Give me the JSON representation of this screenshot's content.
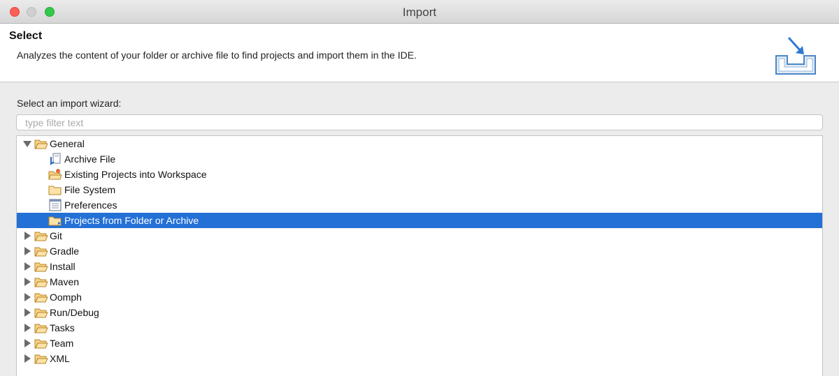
{
  "window": {
    "title": "Import"
  },
  "banner": {
    "title": "Select",
    "description": "Analyzes the content of your folder or archive file to find projects and import them in the IDE.",
    "icon": "import-wizard-icon"
  },
  "wizard": {
    "label": "Select an import wizard:",
    "filter_placeholder": "type filter text",
    "filter_value": ""
  },
  "tree": {
    "general": {
      "label": "General",
      "expanded": true,
      "children": [
        {
          "label": "Archive File",
          "icon": "archive-file-icon"
        },
        {
          "label": "Existing Projects into Workspace",
          "icon": "existing-projects-icon"
        },
        {
          "label": "File System",
          "icon": "folder-icon"
        },
        {
          "label": "Preferences",
          "icon": "preferences-icon"
        },
        {
          "label": "Projects from Folder or Archive",
          "icon": "folder-icon",
          "selected": true
        }
      ]
    },
    "categories": [
      {
        "label": "Git"
      },
      {
        "label": "Gradle"
      },
      {
        "label": "Install"
      },
      {
        "label": "Maven"
      },
      {
        "label": "Oomph"
      },
      {
        "label": "Run/Debug"
      },
      {
        "label": "Tasks"
      },
      {
        "label": "Team"
      },
      {
        "label": "XML"
      }
    ]
  },
  "colors": {
    "selection": "#2370d7",
    "folder": "#f5c04a",
    "close": "#fc5f57",
    "maximize": "#34c84a"
  }
}
